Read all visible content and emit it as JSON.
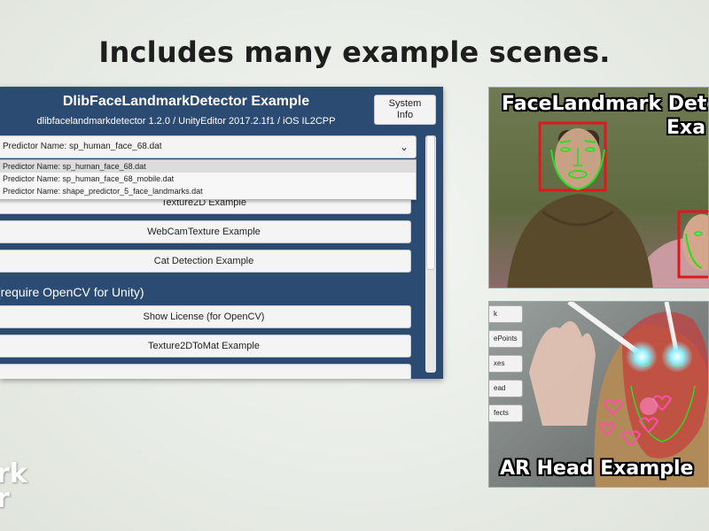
{
  "headline": "Includes many example scenes.",
  "panel": {
    "title": "DlibFaceLandmarkDetector Example",
    "subtitle": "dlibfacelandmarkdetector 1.2.0 / UnityEditor 2017.2.1f1 / iOS IL2CPP",
    "system_info_line1": "System",
    "system_info_line2": "Info",
    "dropdown_value": "Predictor Name: sp_human_face_68.dat",
    "dropdown_options": [
      "Predictor Name: sp_human_face_68.dat",
      "Predictor Name: sp_human_face_68_mobile.dat",
      "Predictor Name: shape_predictor_5_face_landmarks.dat"
    ],
    "buttons": [
      "Texture2D Example",
      "WebCamTexture Example",
      "Cat Detection Example"
    ],
    "section_label": "(require OpenCV for Unity)",
    "opencv_buttons": [
      "Show License (for OpenCV)",
      "Texture2DToMat Example"
    ]
  },
  "screenshots": {
    "top_caption_line1": "FaceLandmark Detec",
    "top_caption_line2": "Exa",
    "bottom_caption": "AR Head Example",
    "bottom_buttons": [
      "k",
      "ePoints",
      "xes",
      "ead",
      "fects"
    ]
  },
  "wordmark": {
    "line1": "rk",
    "line2": "r"
  },
  "colors": {
    "panel_bg": "#2c4b73",
    "face_box": "#e0181e",
    "landmarks": "#22e022"
  }
}
